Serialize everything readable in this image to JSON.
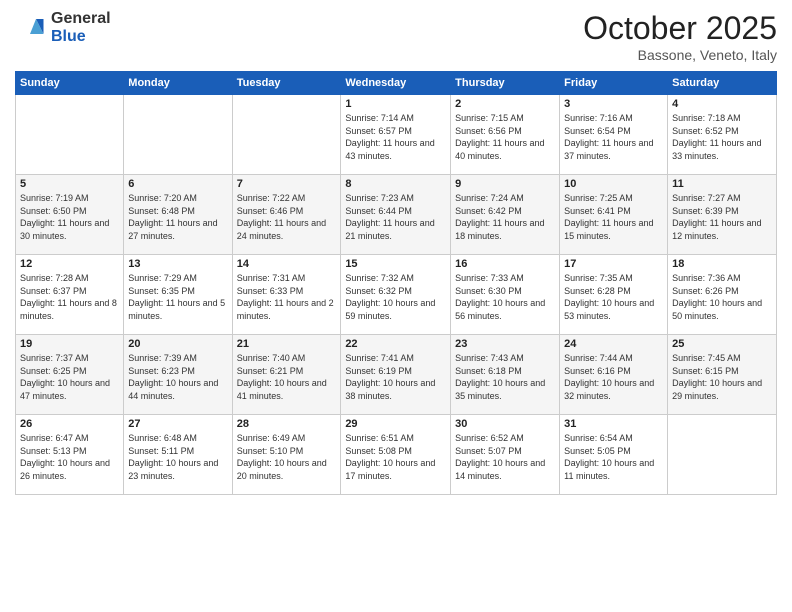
{
  "header": {
    "logo_general": "General",
    "logo_blue": "Blue",
    "month_title": "October 2025",
    "location": "Bassone, Veneto, Italy"
  },
  "days_of_week": [
    "Sunday",
    "Monday",
    "Tuesday",
    "Wednesday",
    "Thursday",
    "Friday",
    "Saturday"
  ],
  "weeks": [
    [
      {
        "day": "",
        "info": ""
      },
      {
        "day": "",
        "info": ""
      },
      {
        "day": "",
        "info": ""
      },
      {
        "day": "1",
        "info": "Sunrise: 7:14 AM\nSunset: 6:57 PM\nDaylight: 11 hours and 43 minutes."
      },
      {
        "day": "2",
        "info": "Sunrise: 7:15 AM\nSunset: 6:56 PM\nDaylight: 11 hours and 40 minutes."
      },
      {
        "day": "3",
        "info": "Sunrise: 7:16 AM\nSunset: 6:54 PM\nDaylight: 11 hours and 37 minutes."
      },
      {
        "day": "4",
        "info": "Sunrise: 7:18 AM\nSunset: 6:52 PM\nDaylight: 11 hours and 33 minutes."
      }
    ],
    [
      {
        "day": "5",
        "info": "Sunrise: 7:19 AM\nSunset: 6:50 PM\nDaylight: 11 hours and 30 minutes."
      },
      {
        "day": "6",
        "info": "Sunrise: 7:20 AM\nSunset: 6:48 PM\nDaylight: 11 hours and 27 minutes."
      },
      {
        "day": "7",
        "info": "Sunrise: 7:22 AM\nSunset: 6:46 PM\nDaylight: 11 hours and 24 minutes."
      },
      {
        "day": "8",
        "info": "Sunrise: 7:23 AM\nSunset: 6:44 PM\nDaylight: 11 hours and 21 minutes."
      },
      {
        "day": "9",
        "info": "Sunrise: 7:24 AM\nSunset: 6:42 PM\nDaylight: 11 hours and 18 minutes."
      },
      {
        "day": "10",
        "info": "Sunrise: 7:25 AM\nSunset: 6:41 PM\nDaylight: 11 hours and 15 minutes."
      },
      {
        "day": "11",
        "info": "Sunrise: 7:27 AM\nSunset: 6:39 PM\nDaylight: 11 hours and 12 minutes."
      }
    ],
    [
      {
        "day": "12",
        "info": "Sunrise: 7:28 AM\nSunset: 6:37 PM\nDaylight: 11 hours and 8 minutes."
      },
      {
        "day": "13",
        "info": "Sunrise: 7:29 AM\nSunset: 6:35 PM\nDaylight: 11 hours and 5 minutes."
      },
      {
        "day": "14",
        "info": "Sunrise: 7:31 AM\nSunset: 6:33 PM\nDaylight: 11 hours and 2 minutes."
      },
      {
        "day": "15",
        "info": "Sunrise: 7:32 AM\nSunset: 6:32 PM\nDaylight: 10 hours and 59 minutes."
      },
      {
        "day": "16",
        "info": "Sunrise: 7:33 AM\nSunset: 6:30 PM\nDaylight: 10 hours and 56 minutes."
      },
      {
        "day": "17",
        "info": "Sunrise: 7:35 AM\nSunset: 6:28 PM\nDaylight: 10 hours and 53 minutes."
      },
      {
        "day": "18",
        "info": "Sunrise: 7:36 AM\nSunset: 6:26 PM\nDaylight: 10 hours and 50 minutes."
      }
    ],
    [
      {
        "day": "19",
        "info": "Sunrise: 7:37 AM\nSunset: 6:25 PM\nDaylight: 10 hours and 47 minutes."
      },
      {
        "day": "20",
        "info": "Sunrise: 7:39 AM\nSunset: 6:23 PM\nDaylight: 10 hours and 44 minutes."
      },
      {
        "day": "21",
        "info": "Sunrise: 7:40 AM\nSunset: 6:21 PM\nDaylight: 10 hours and 41 minutes."
      },
      {
        "day": "22",
        "info": "Sunrise: 7:41 AM\nSunset: 6:19 PM\nDaylight: 10 hours and 38 minutes."
      },
      {
        "day": "23",
        "info": "Sunrise: 7:43 AM\nSunset: 6:18 PM\nDaylight: 10 hours and 35 minutes."
      },
      {
        "day": "24",
        "info": "Sunrise: 7:44 AM\nSunset: 6:16 PM\nDaylight: 10 hours and 32 minutes."
      },
      {
        "day": "25",
        "info": "Sunrise: 7:45 AM\nSunset: 6:15 PM\nDaylight: 10 hours and 29 minutes."
      }
    ],
    [
      {
        "day": "26",
        "info": "Sunrise: 6:47 AM\nSunset: 5:13 PM\nDaylight: 10 hours and 26 minutes."
      },
      {
        "day": "27",
        "info": "Sunrise: 6:48 AM\nSunset: 5:11 PM\nDaylight: 10 hours and 23 minutes."
      },
      {
        "day": "28",
        "info": "Sunrise: 6:49 AM\nSunset: 5:10 PM\nDaylight: 10 hours and 20 minutes."
      },
      {
        "day": "29",
        "info": "Sunrise: 6:51 AM\nSunset: 5:08 PM\nDaylight: 10 hours and 17 minutes."
      },
      {
        "day": "30",
        "info": "Sunrise: 6:52 AM\nSunset: 5:07 PM\nDaylight: 10 hours and 14 minutes."
      },
      {
        "day": "31",
        "info": "Sunrise: 6:54 AM\nSunset: 5:05 PM\nDaylight: 10 hours and 11 minutes."
      },
      {
        "day": "",
        "info": ""
      }
    ]
  ]
}
